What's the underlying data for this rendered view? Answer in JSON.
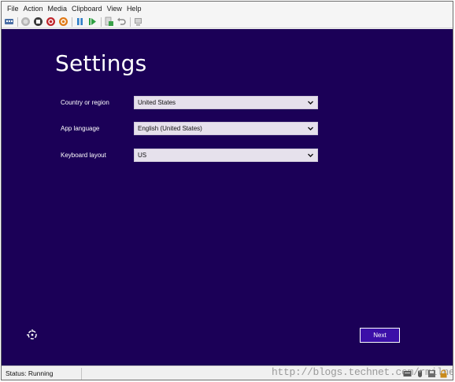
{
  "menu": [
    "File",
    "Action",
    "Media",
    "Clipboard",
    "View",
    "Help"
  ],
  "toolbar_icons": [
    "ctrl-alt-del-icon",
    "start-icon",
    "turn-off-icon",
    "shut-down-icon",
    "power-icon",
    "pause-icon",
    "resume-icon",
    "checkpoint-icon",
    "revert-icon",
    "enhanced-session-icon"
  ],
  "setup": {
    "title": "Settings",
    "fields": [
      {
        "label": "Country or region",
        "value": "United States"
      },
      {
        "label": "App language",
        "value": "English (United States)"
      },
      {
        "label": "Keyboard layout",
        "value": "US"
      }
    ],
    "next_label": "Next"
  },
  "status": {
    "text": "Status: Running",
    "watermark": "http://blogs.technet.com/rmilne"
  },
  "colors": {
    "screen_bg": "#1b0057",
    "button_bg": "#3b0fa8",
    "select_bg": "#e6e1ec"
  }
}
